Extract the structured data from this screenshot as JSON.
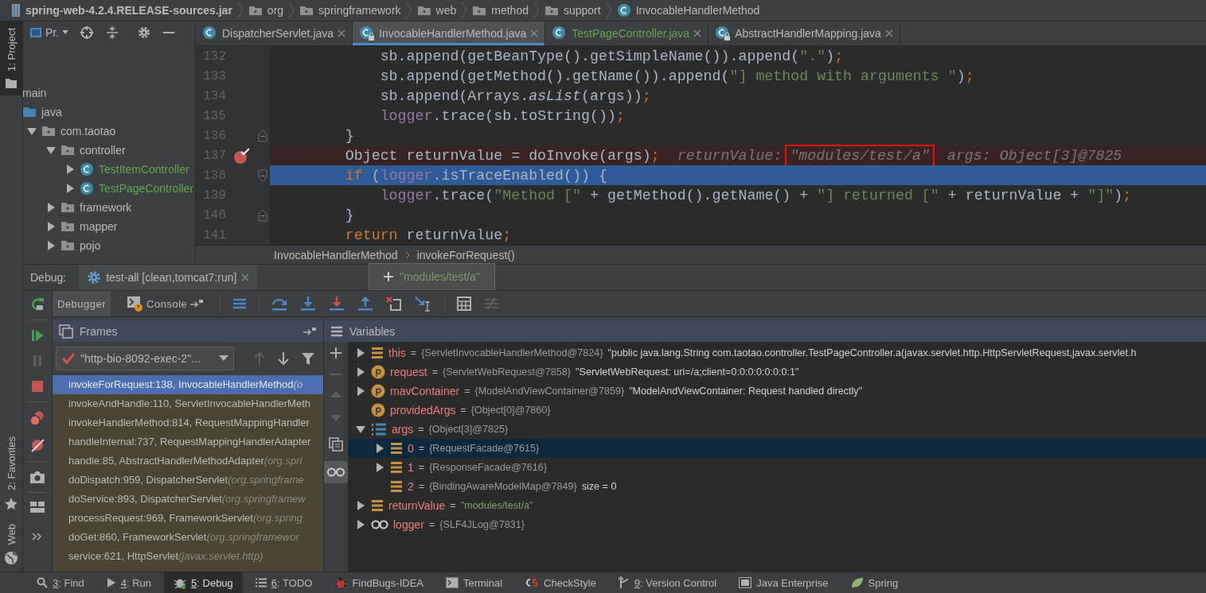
{
  "breadcrumb": [
    {
      "kind": "jar",
      "label": "spring-web-4.2.4.RELEASE-sources.jar"
    },
    {
      "kind": "package",
      "label": "org"
    },
    {
      "kind": "package",
      "label": "springframework"
    },
    {
      "kind": "package",
      "label": "web"
    },
    {
      "kind": "package",
      "label": "method"
    },
    {
      "kind": "package",
      "label": "support"
    },
    {
      "kind": "class",
      "label": "InvocableHandlerMethod"
    }
  ],
  "tool_strip": {
    "top": [
      {
        "kind": "project",
        "key": "1",
        "label": ": Project",
        "selected": true
      }
    ],
    "bottom": [
      {
        "kind": "favorites",
        "key": "2",
        "label": ": Favorites",
        "selected": false
      },
      {
        "kind": "web",
        "label": "Web",
        "selected": false
      }
    ]
  },
  "project_panel": {
    "view": "Pr.",
    "tree": [
      {
        "label": "main",
        "color": "#bbbbbb",
        "children": [
          {
            "label": "java",
            "kind": "source-root",
            "color": "#bbbbbb",
            "children": [
              {
                "label": "com.taotao",
                "kind": "package",
                "color": "#bbbbbb",
                "expanded": true,
                "children": [
                  {
                    "label": "controller",
                    "kind": "package",
                    "color": "#bbbbbb",
                    "expanded": true,
                    "children": [
                      {
                        "label": "TestItemController",
                        "kind": "class",
                        "color": "#62a84a",
                        "expanded": false
                      },
                      {
                        "label": "TestPageController",
                        "kind": "class",
                        "color": "#62a84a",
                        "expanded": false
                      }
                    ]
                  },
                  {
                    "label": "framework",
                    "kind": "package",
                    "color": "#bbbbbb",
                    "expanded": false
                  },
                  {
                    "label": "mapper",
                    "kind": "package",
                    "color": "#bbbbbb",
                    "expanded": false
                  },
                  {
                    "label": "pojo",
                    "kind": "package",
                    "color": "#bbbbbb",
                    "expanded": false
                  }
                ]
              }
            ]
          }
        ]
      }
    ]
  },
  "editor": {
    "tabs": [
      {
        "label": "DispatcherServlet.java",
        "selected": false,
        "locked": false,
        "color": "#bbbbbb"
      },
      {
        "label": "InvocableHandlerMethod.java",
        "selected": true,
        "locked": true,
        "color": "#bbbbbb"
      },
      {
        "label": "TestPageController.java",
        "selected": false,
        "locked": false,
        "color": "#62a84a"
      },
      {
        "label": "AbstractHandlerMapping.java",
        "selected": false,
        "locked": true,
        "color": "#bbbbbb"
      }
    ],
    "lines": [
      {
        "number": "132",
        "breakpoint": false,
        "current": false,
        "tokens": [
          {
            "kind": "plain",
            "text": "            sb.append(getBeanType().getSimpleName()).append("
          },
          {
            "kind": "string",
            "text": "\".\""
          },
          {
            "kind": "plain",
            "text": ")"
          },
          {
            "kind": "semi",
            "text": ";"
          }
        ]
      },
      {
        "number": "133",
        "breakpoint": false,
        "current": false,
        "tokens": [
          {
            "kind": "plain",
            "text": "            sb.append(getMethod().getName()).append("
          },
          {
            "kind": "string",
            "text": "\"] method with arguments \""
          },
          {
            "kind": "plain",
            "text": ")"
          },
          {
            "kind": "semi",
            "text": ";"
          }
        ]
      },
      {
        "number": "134",
        "breakpoint": false,
        "current": false,
        "tokens": [
          {
            "kind": "plain",
            "text": "            sb.append(Arrays."
          },
          {
            "kind": "static",
            "text": "asList"
          },
          {
            "kind": "plain",
            "text": "(args))"
          },
          {
            "kind": "semi",
            "text": ";"
          }
        ]
      },
      {
        "number": "135",
        "breakpoint": false,
        "current": false,
        "tokens": [
          {
            "kind": "field",
            "text": "            logger"
          },
          {
            "kind": "plain",
            "text": ".trace(sb.toString())"
          },
          {
            "kind": "semi",
            "text": ";"
          }
        ]
      },
      {
        "number": "136",
        "breakpoint": false,
        "current": false,
        "fold": {
          "kind": "end"
        },
        "tokens": [
          {
            "kind": "plain",
            "text": "        }"
          }
        ]
      },
      {
        "number": "137",
        "breakpoint": true,
        "current": false,
        "tokens": [
          {
            "kind": "plain",
            "text": "        Object returnValue = doInvoke(args)"
          },
          {
            "kind": "semi",
            "text": ";"
          },
          {
            "kind": "hint",
            "text": "returnValue:"
          },
          {
            "kind": "boxed",
            "text": "\"modules/test/a\""
          },
          {
            "kind": "hint",
            "text": "args: Object[3]@7825"
          }
        ]
      },
      {
        "number": "138",
        "breakpoint": false,
        "current": true,
        "fold": {
          "kind": "start"
        },
        "tokens": [
          {
            "kind": "keyword",
            "text": "        if"
          },
          {
            "kind": "plain",
            "text": " ("
          },
          {
            "kind": "field",
            "text": "logger"
          },
          {
            "kind": "plain",
            "text": ".isTraceEnabled()) {"
          }
        ]
      },
      {
        "number": "139",
        "breakpoint": false,
        "current": false,
        "tokens": [
          {
            "kind": "field",
            "text": "            logger"
          },
          {
            "kind": "plain",
            "text": ".trace("
          },
          {
            "kind": "string",
            "text": "\"Method [\""
          },
          {
            "kind": "plain",
            "text": " + getMethod().getName() + "
          },
          {
            "kind": "string",
            "text": "\"] returned [\""
          },
          {
            "kind": "plain",
            "text": " + returnValue + "
          },
          {
            "kind": "string",
            "text": "\"]\""
          },
          {
            "kind": "plain",
            "text": ")"
          },
          {
            "kind": "semi",
            "text": ";"
          }
        ]
      },
      {
        "number": "140",
        "breakpoint": false,
        "current": false,
        "fold": {
          "kind": "end"
        },
        "tokens": [
          {
            "kind": "plain",
            "text": "        }"
          }
        ]
      },
      {
        "number": "141",
        "breakpoint": false,
        "current": false,
        "tokens": [
          {
            "kind": "keyword",
            "text": "        return"
          },
          {
            "kind": "plain",
            "text": " returnValue"
          },
          {
            "kind": "semi",
            "text": ";"
          }
        ]
      }
    ],
    "breadcrumb": [
      "InvocableHandlerMethod",
      "invokeForRequest()"
    ]
  },
  "debug": {
    "title": "Debug:",
    "session": "test-all [clean,tomcat7:run]",
    "tooltip": "\"modules/test/a\"",
    "tabs": [
      {
        "kind": "debugger",
        "label": "Debugger",
        "selected": true
      },
      {
        "kind": "console",
        "label": "Console",
        "selected": false
      }
    ],
    "frames": {
      "title": "Frames",
      "thread": "\"http-bio-8092-exec-2\"...",
      "items": [
        {
          "text": "invokeForRequest:138, InvocableHandlerMethod",
          "location": "(o",
          "selected": true
        },
        {
          "text": "invokeAndHandle:110, ServletInvocableHandlerMeth",
          "selected": false
        },
        {
          "text": "invokeHandlerMethod:814, RequestMappingHandler",
          "selected": false
        },
        {
          "text": "handleInternal:737, RequestMappingHandlerAdapter",
          "selected": false
        },
        {
          "text": "handle:85, AbstractHandlerMethodAdapter",
          "location": "(org.spri",
          "selected": false
        },
        {
          "text": "doDispatch:959, DispatcherServlet",
          "location": "(org.springframe",
          "selected": false
        },
        {
          "text": "doService:893, DispatcherServlet",
          "location": "(org.springframew",
          "selected": false
        },
        {
          "text": "processRequest:969, FrameworkServlet",
          "location": "(org.spring",
          "selected": false
        },
        {
          "text": "doGet:860, FrameworkServlet",
          "location": "(org.springframewor",
          "selected": false
        },
        {
          "text": "service:621, HttpServlet",
          "location": "(javax.servlet.http)",
          "selected": false
        }
      ]
    },
    "variables": {
      "title": "Variables",
      "items": [
        {
          "kind": "field",
          "name": "this",
          "sep": "=",
          "ref": "{ServletInvocableHandlerMethod@7824}",
          "value": "\"public java.lang.String com.taotao.controller.TestPageController.a(javax.servlet.http.HttpServletRequest,javax.servlet.h",
          "string_value": false,
          "expanded": false,
          "selected": false
        },
        {
          "kind": "parameter",
          "name": "request",
          "sep": "=",
          "ref": "{ServletWebRequest@7858}",
          "value": "\"ServletWebRequest: uri=/a;client=0:0:0:0:0:0:0:1\"",
          "string_value": false,
          "expanded": false,
          "selected": false
        },
        {
          "kind": "parameter",
          "name": "mavContainer",
          "sep": "=",
          "ref": "{ModelAndViewContainer@7859}",
          "value": "\"ModelAndViewContainer: Request handled directly\"",
          "string_value": false,
          "expanded": false,
          "selected": false
        },
        {
          "kind": "parameter",
          "name": "providedArgs",
          "sep": "=",
          "ref": "{Object[0]@7860}",
          "selected": false
        },
        {
          "kind": "array",
          "name": "args",
          "sep": "=",
          "ref": "{Object[3]@7825}",
          "expanded": true,
          "selected": false,
          "children": [
            {
              "kind": "field",
              "name": "0",
              "sep": "=",
              "ref": "{RequestFacade@7615}",
              "expanded": false,
              "selected": true
            },
            {
              "kind": "field",
              "name": "1",
              "sep": "=",
              "ref": "{ResponseFacade@7616}",
              "expanded": false,
              "selected": false
            },
            {
              "kind": "field",
              "name": "2",
              "sep": "=",
              "ref": "{BindingAwareModelMap@7849}",
              "value": "size = 0",
              "string_value": false,
              "selected": false
            }
          ]
        },
        {
          "kind": "field",
          "name": "returnValue",
          "sep": "=",
          "value": "\"modules/test/a\"",
          "string_value": true,
          "expanded": false,
          "selected": false
        },
        {
          "kind": "watch",
          "name": "logger",
          "sep": "=",
          "ref": "{SLF4JLog@7831}",
          "expanded": false,
          "selected": false
        }
      ]
    }
  },
  "bottom_bar": [
    {
      "kind": "find",
      "key": "3",
      "label": ": Find",
      "selected": false
    },
    {
      "kind": "run",
      "key": "4",
      "label": ": Run",
      "selected": false
    },
    {
      "kind": "debug",
      "key": "5",
      "label": ": Debug",
      "selected": true
    },
    {
      "kind": "todo",
      "key": "6",
      "label": ": TODO",
      "selected": false
    },
    {
      "kind": "findbugs",
      "label": "FindBugs-IDEA",
      "selected": false
    },
    {
      "kind": "terminal",
      "label": "Terminal",
      "selected": false
    },
    {
      "kind": "checkstyle",
      "label": "CheckStyle",
      "selected": false
    },
    {
      "kind": "vcs",
      "key": "9",
      "label": ": Version Control",
      "selected": false
    },
    {
      "kind": "javaee",
      "label": "Java Enterprise",
      "selected": false
    },
    {
      "kind": "spring",
      "label": "Spring",
      "selected": false
    }
  ]
}
